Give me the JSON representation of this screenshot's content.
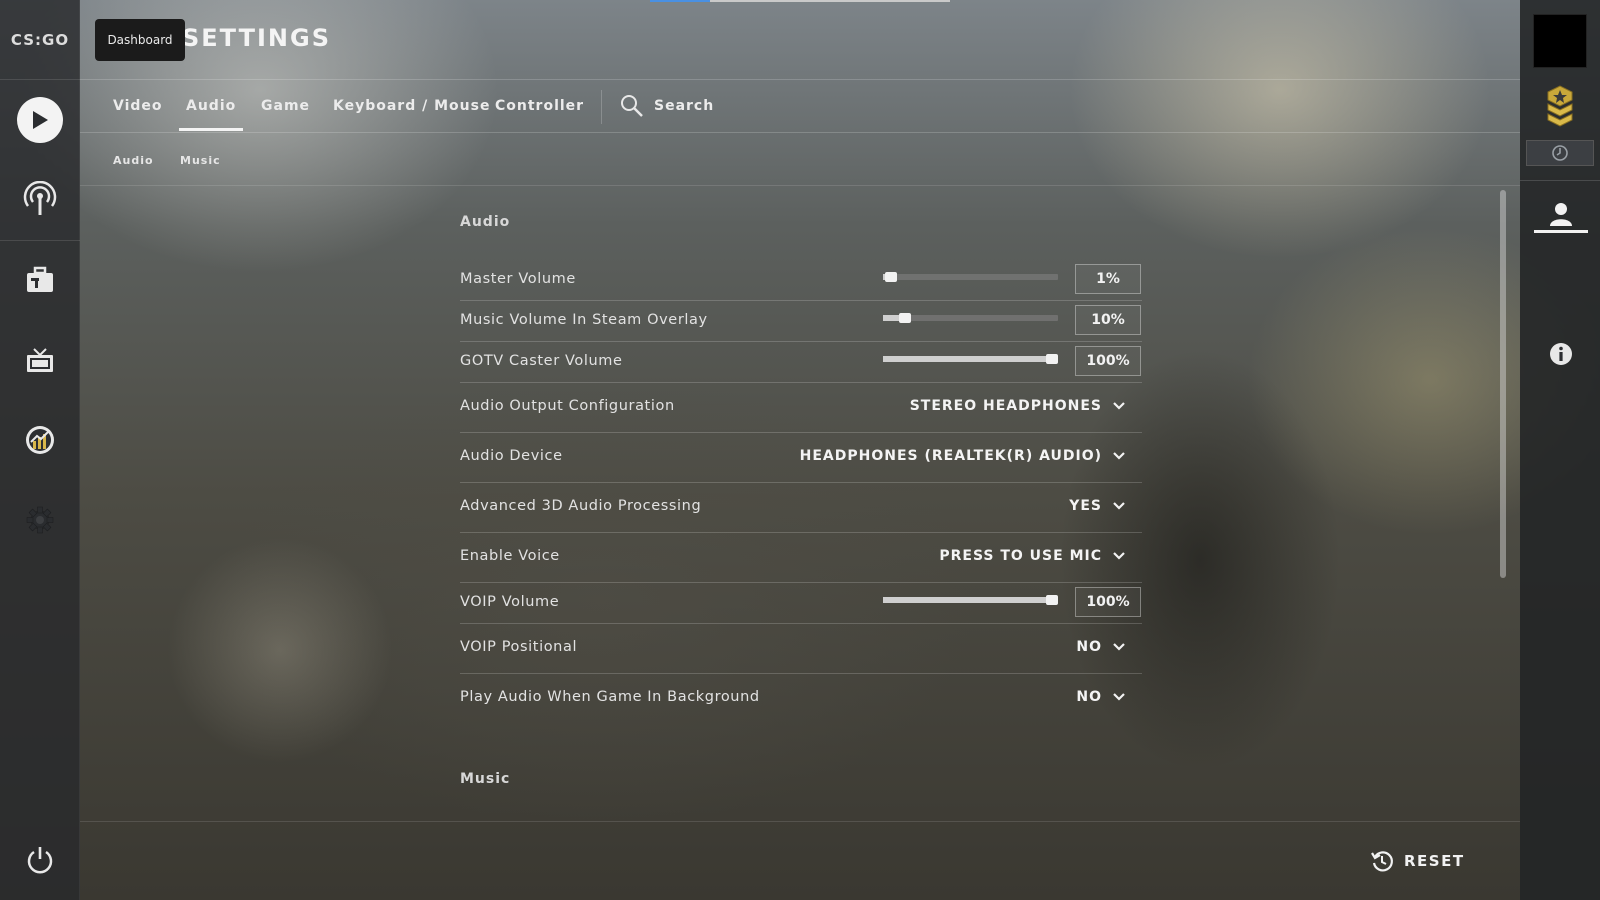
{
  "app": {
    "logo_text": "CS:GO",
    "page_title": "SETTINGS",
    "tooltip": "Dashboard"
  },
  "left_nav": [
    {
      "name": "play",
      "icon": "play-icon"
    },
    {
      "name": "watch-broadcast",
      "icon": "broadcast-icon"
    },
    {
      "name": "inventory",
      "icon": "briefcase-icon"
    },
    {
      "name": "watch",
      "icon": "tv-icon"
    },
    {
      "name": "stats",
      "icon": "stats-icon"
    },
    {
      "name": "settings",
      "icon": "gear-icon"
    },
    {
      "name": "quit",
      "icon": "power-icon"
    }
  ],
  "tabs": [
    "Video",
    "Audio",
    "Game",
    "Keyboard / Mouse",
    "Controller"
  ],
  "active_tab": "Audio",
  "search_label": "Search",
  "subtabs": [
    "Audio",
    "Music"
  ],
  "sections": {
    "audio_title": "Audio",
    "music_title": "Music"
  },
  "settings": {
    "master_volume": {
      "label": "Master Volume",
      "value": "1%",
      "level": 0.01
    },
    "music_volume_overlay": {
      "label": "Music Volume In Steam Overlay",
      "value": "10%",
      "level": 0.1
    },
    "gotv_caster_volume": {
      "label": "GOTV Caster Volume",
      "value": "100%",
      "level": 1.0
    },
    "audio_output": {
      "label": "Audio Output Configuration",
      "value": "STEREO HEADPHONES"
    },
    "audio_device": {
      "label": "Audio Device",
      "value": "HEADPHONES (REALTEK(R) AUDIO)"
    },
    "advanced_3d": {
      "label": "Advanced 3D Audio Processing",
      "value": "YES"
    },
    "enable_voice": {
      "label": "Enable Voice",
      "value": "PRESS TO USE MIC"
    },
    "voip_volume": {
      "label": "VOIP Volume",
      "value": "100%",
      "level": 1.0
    },
    "voip_positional": {
      "label": "VOIP Positional",
      "value": "NO"
    },
    "play_audio_background": {
      "label": "Play Audio When Game In Background",
      "value": "NO"
    }
  },
  "footer": {
    "reset_label": "RESET"
  },
  "colors": {
    "accent": "#4a90e2",
    "text": "#f2f2f2"
  }
}
